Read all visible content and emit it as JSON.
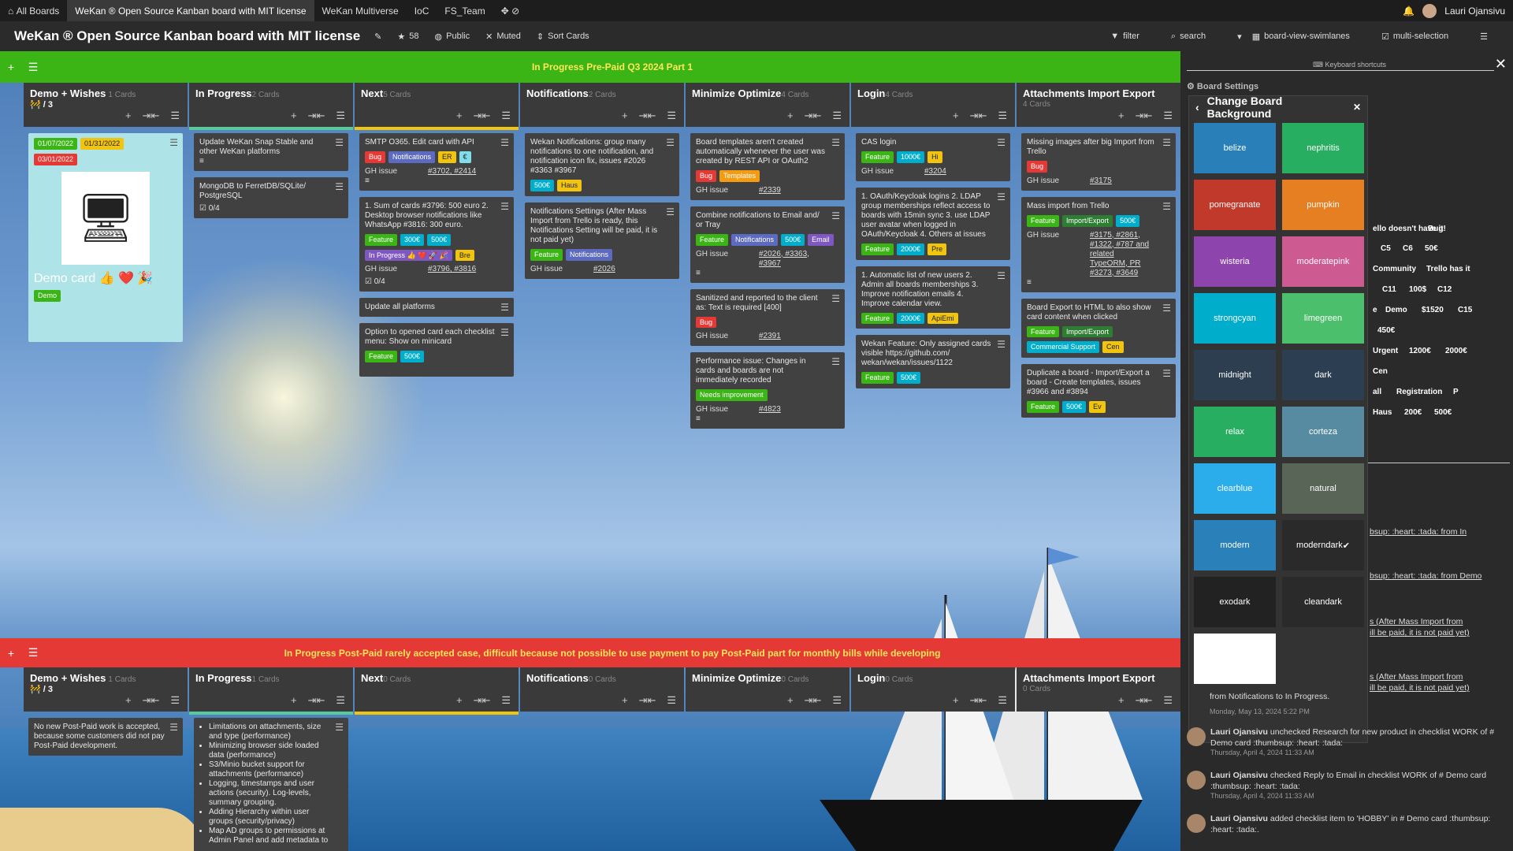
{
  "topbar": {
    "tabs": [
      "All Boards",
      "WeKan ® Open Source Kanban board with MIT license",
      "WeKan Multiverse",
      "IoC",
      "FS_Team"
    ],
    "user": "Lauri Ojansivu"
  },
  "header": {
    "title": "WeKan ® Open Source Kanban board with MIT license",
    "stars": "58",
    "visibility": "Public",
    "watch": "Muted",
    "sort": "Sort Cards",
    "filter": "filter",
    "search": "search",
    "view": "board-view-swimlanes",
    "multi": "multi-selection"
  },
  "swimlanes": [
    {
      "title": "In Progress Pre-Paid Q3 2024 Part 1",
      "color": "#3bb516"
    },
    {
      "title": "In Progress Post-Paid rarely accepted case, difficult because not possible to use payment to pay Post-Paid part for monthly bills while developing",
      "color": "#e53935"
    }
  ],
  "lists": [
    {
      "title": "Demo + Wishes",
      "count": "1 Cards",
      "extra": "🚧 / 3",
      "bar": "#3a3a3a"
    },
    {
      "title": "In Progress",
      "count": "2 Cards",
      "bar": "#57c99b"
    },
    {
      "title": "Next",
      "count": "5 Cards",
      "bar": "#f1c40f"
    },
    {
      "title": "Notifications",
      "count": "2 Cards",
      "bar": "#3a3a3a"
    },
    {
      "title": "Minimize Optimize",
      "count": "4 Cards",
      "bar": "#3a3a3a"
    },
    {
      "title": "Login",
      "count": "4 Cards",
      "bar": "#3a3a3a"
    },
    {
      "title": "Attachments Import Export",
      "count": "4 Cards",
      "bar": "#3a3a3a"
    }
  ],
  "lists2": [
    {
      "title": "Demo + Wishes",
      "count": "1 Cards",
      "extra": "🚧 / 3"
    },
    {
      "title": "In Progress",
      "count": "1 Cards"
    },
    {
      "title": "Next",
      "count": "0 Cards"
    },
    {
      "title": "Notifications",
      "count": "0 Cards"
    },
    {
      "title": "Minimize Optimize",
      "count": "0 Cards"
    },
    {
      "title": "Login",
      "count": "0 Cards"
    },
    {
      "title": "Attachments Import Export",
      "count": "0 Cards"
    }
  ],
  "cards": {
    "demo": {
      "date1": "01/07/2022",
      "date2": "01/31/2022",
      "due": "03/01/2022",
      "title": "Demo card 👍 ❤️ 🎉",
      "label": "Demo"
    },
    "ip1": "Update WeKan Snap Stable and other WeKan platforms",
    "ip2": "MongoDB to FerretDB/SQLite/ PostgreSQL",
    "ip2check": "0/4",
    "next1": {
      "title": "SMTP O365. Edit card with API",
      "labels": [
        "Bug",
        "Notifications",
        "ER",
        "€"
      ],
      "gh": "GH issue",
      "links": "#3702, #2414"
    },
    "next2": {
      "title": "1. Sum of cards #3796: 500 euro 2. Desktop browser notifications like WhatsApp #3816: 300 euro.",
      "labels": [
        "Feature",
        "300€",
        "500€",
        "In Progress 👍 ❤️ 🚀 🎉",
        "Bre"
      ],
      "gh": "GH issue",
      "links": "#3796, #3816",
      "check": "0/4"
    },
    "next3": "Update all platforms",
    "next4": {
      "title": "Option to opened card each checklist menu: Show on minicard",
      "labels": [
        "Feature",
        "500€"
      ]
    },
    "notif1": {
      "title": "Wekan Notifications: group many notifications to one notification, and notification icon fix, issues #2026 #3363 #3967",
      "labels": [
        "500€",
        "Haus"
      ]
    },
    "notif2": {
      "title": "Notifications Settings (After Mass Import from Trello is ready, this Notifications Setting will be paid, it is not paid yet)",
      "labels": [
        "Feature",
        "Notifications"
      ],
      "gh": "GH issue",
      "links": "#2026"
    },
    "min1": {
      "title": "Board templates aren't created automatically whenever the user was created by REST API or OAuth2",
      "labels": [
        "Bug",
        "Templates"
      ],
      "gh": "GH issue",
      "links": "#2339"
    },
    "min2": {
      "title": "Combine notifications to Email and/ or Tray",
      "labels": [
        "Feature",
        "Notifications",
        "500€",
        "Email"
      ],
      "gh": "GH issue",
      "links": "#2026, #3363, #3967"
    },
    "min3": {
      "title": "Sanitized and reported to the client as: Text is required [400]",
      "labels": [
        "Bug"
      ],
      "gh": "GH issue",
      "links": "#2391"
    },
    "min4": {
      "title": "Performance issue: Changes in cards and boards are not immediately recorded",
      "labels": [
        "Needs improvement"
      ],
      "gh": "GH issue",
      "links": "#4823"
    },
    "login1": {
      "title": "CAS login",
      "labels": [
        "Feature",
        "1000€",
        "Hi"
      ],
      "gh": "GH issue",
      "links": "#3204"
    },
    "login2": {
      "title": "1. OAuth/Keycloak logins 2. LDAP group memberships reflect access to boards with 15min sync 3. use LDAP user avatar when logged in OAuth/Keycloak 4. Others at issues",
      "labels": [
        "Feature",
        "2000€",
        "Pre"
      ]
    },
    "login3": {
      "title": "1. Automatic list of new users 2. Admin all boards memberships 3. Improve notification emails 4. Improve calendar view.",
      "labels": [
        "Feature",
        "2000€",
        "ApiEmi"
      ]
    },
    "login4": {
      "title": "Wekan Feature: Only assigned cards visible https://github.com/ wekan/wekan/issues/1122",
      "labels": [
        "Feature",
        "500€"
      ]
    },
    "att1": {
      "title": "Missing images after big Import from Trello",
      "labels": [
        "Bug"
      ],
      "gh": "GH issue",
      "links": "#3175"
    },
    "att2": {
      "title": "Mass import from Trello",
      "labels": [
        "Feature",
        "Import/Export",
        "500€"
      ],
      "gh": "GH issue",
      "links": "#3175, #2861, #1322, #787 and related TypeORM, PR #3273, #3649"
    },
    "att3": {
      "title": "Board Export to HTML to also show card content when clicked",
      "labels": [
        "Feature",
        "Import/Export",
        "Commercial Support",
        "Cen"
      ]
    },
    "att4": {
      "title": "Duplicate a board - Import/Export a board - Create templates, issues #3966 and #3894",
      "labels": [
        "Feature",
        "500€",
        "Ev"
      ]
    },
    "post1": "No new Post-Paid work is accepted, because some customers did not pay Post-Paid development.",
    "post2": [
      "Limitations on attachments, size and type (performance)",
      "Minimizing browser side loaded data (performance)",
      "S3/Minio bucket support for attachments (performance)",
      "Logging, timestamps and user actions (security). Log-levels, summary grouping.",
      "Adding Hierarchy within user groups (security/privacy)",
      "Map AD groups to permissions at Admin Panel and add metadata to"
    ]
  },
  "panel": {
    "shortcuts": "Keyboard shortcuts",
    "settings": "Board Settings",
    "cbg_title": "Change Board Background",
    "swatches": [
      {
        "name": "belize",
        "color": "#2980b9"
      },
      {
        "name": "nephritis",
        "color": "#27ae60"
      },
      {
        "name": "pomegranate",
        "color": "#c0392b"
      },
      {
        "name": "pumpkin",
        "color": "#e67e22"
      },
      {
        "name": "wisteria",
        "color": "#8e44ad"
      },
      {
        "name": "moderatepink",
        "color": "#cd5a91"
      },
      {
        "name": "strongcyan",
        "color": "#00aecc"
      },
      {
        "name": "limegreen",
        "color": "#4bbf6b"
      },
      {
        "name": "midnight",
        "color": "#2c3e50"
      },
      {
        "name": "dark",
        "color": "#2c3e51"
      },
      {
        "name": "relax",
        "color": "#27ae61"
      },
      {
        "name": "corteza",
        "color": "#568ba2"
      },
      {
        "name": "clearblue",
        "color": "#2cadeb"
      },
      {
        "name": "natural",
        "color": "#596557"
      },
      {
        "name": "modern",
        "color": "#2a80b8"
      },
      {
        "name": "moderndark",
        "color": "#2a2a2a"
      },
      {
        "name": "exodark",
        "color": "#222222"
      },
      {
        "name": "cleandark",
        "color": "#2a2a2a"
      },
      {
        "name": "",
        "color": "#ffffff"
      }
    ],
    "chips": [
      {
        "t": "ello doesn't have it!",
        "c": "#1e88e5"
      },
      {
        "t": "Bug",
        "c": "#e53935"
      },
      {
        "t": "C5",
        "c": "#f1c40f"
      },
      {
        "t": "C6",
        "c": "#f1c40f"
      },
      {
        "t": "50€",
        "c": "#00aecc"
      },
      {
        "t": "Community",
        "c": "#1e88e5"
      },
      {
        "t": "Trello has it",
        "c": "#1e88e5"
      },
      {
        "t": "C11",
        "c": "#f1c40f"
      },
      {
        "t": "100$",
        "c": "#00aecc"
      },
      {
        "t": "C12",
        "c": "#f1c40f"
      },
      {
        "t": "e",
        "c": "#f1c40f"
      },
      {
        "t": "Demo",
        "c": "#3bb516"
      },
      {
        "t": "$1520",
        "c": "#00aecc"
      },
      {
        "t": "C15",
        "c": "#f1c40f"
      },
      {
        "t": "450€",
        "c": "#00aecc"
      },
      {
        "t": "Urgent",
        "c": "#e53935"
      },
      {
        "t": "1200€",
        "c": "#00aecc"
      },
      {
        "t": "2000€",
        "c": "#00aecc"
      },
      {
        "t": "Cen",
        "c": "#f1c40f"
      },
      {
        "t": "all",
        "c": "#8e44ad"
      },
      {
        "t": "Registration",
        "c": "#e53935"
      },
      {
        "t": "P",
        "c": "#f1c40f"
      },
      {
        "t": "Haus",
        "c": "#f1c40f"
      },
      {
        "t": "200€",
        "c": "#00aecc"
      },
      {
        "t": "500€",
        "c": "#e53935"
      }
    ],
    "partial": [
      "bsup: :heart: :tada: from In",
      "bsup: :heart: :tada: from Demo",
      "s (After Mass Import from",
      "ill be paid, it is not paid yet)",
      "s (After Mass Import from",
      "ill be paid, it is not paid yet)"
    ],
    "a0": {
      "body": "from Notifications to In Progress.",
      "ts": "Monday, May 13, 2024 5:22 PM"
    },
    "a1": {
      "user": "Lauri Ojansivu",
      "body": "unchecked Research for new product in checklist WORK of # Demo card :thumbsup: :heart: :tada:",
      "ts": "Thursday, April 4, 2024 11:33 AM"
    },
    "a2": {
      "user": "Lauri Ojansivu",
      "body": "checked Reply to Email in checklist WORK of # Demo card :thumbsup: :heart: :tada:",
      "ts": "Thursday, April 4, 2024 11:33 AM"
    },
    "a3": {
      "user": "Lauri Ojansivu",
      "body": "added checklist item to 'HOBBY' in # Demo card :thumbsup: :heart: :tada:."
    }
  }
}
